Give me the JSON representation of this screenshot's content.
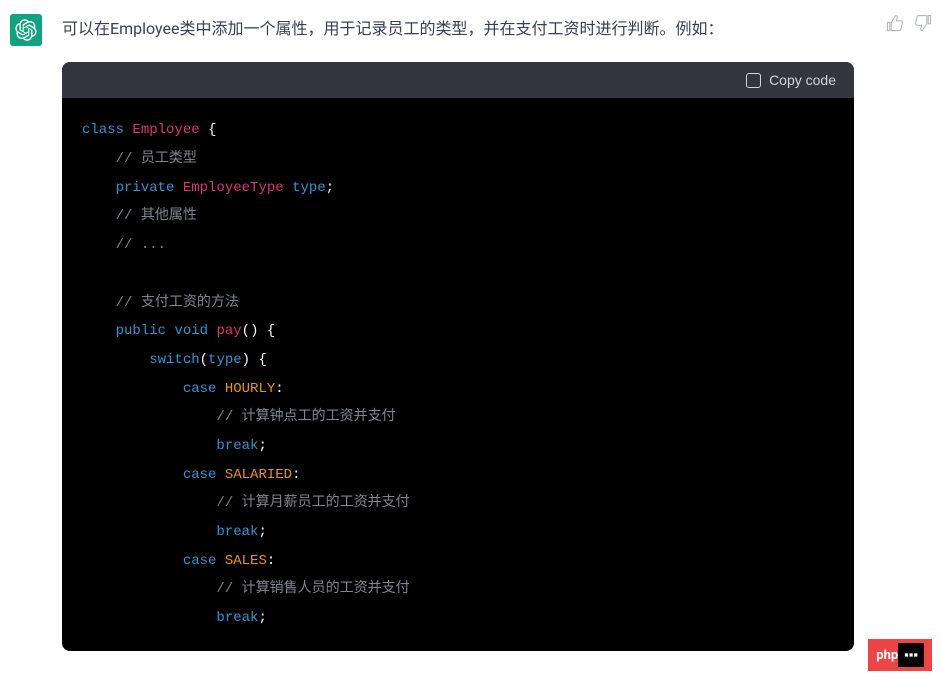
{
  "response": {
    "text": "可以在Employee类中添加一个属性，用于记录员工的类型，并在支付工资时进行判断。例如："
  },
  "code": {
    "copy_label": "Copy code",
    "tokens": {
      "class": "class",
      "employee": "Employee",
      "brace_open": " {",
      "comment_type": "// 员工类型",
      "private": "private",
      "employee_type": "EmployeeType",
      "type_var": "type",
      "semicolon": ";",
      "comment_other": "// 其他属性",
      "comment_dots": "// ...",
      "comment_pay": "// 支付工资的方法",
      "public": "public",
      "void": "void",
      "pay": "pay",
      "parens": "()",
      "switch": "switch",
      "paren_open": "(",
      "paren_close": ")",
      "case": "case",
      "hourly": "HOURLY",
      "colon": ":",
      "comment_hourly": "// 计算钟点工的工资并支付",
      "break": "break",
      "salaried": "SALARIED",
      "comment_salaried": "// 计算月薪员工的工资并支付",
      "sales": "SALES",
      "comment_sales": "// 计算销售人员的工资并支付"
    }
  },
  "watermark": {
    "text": "php"
  }
}
